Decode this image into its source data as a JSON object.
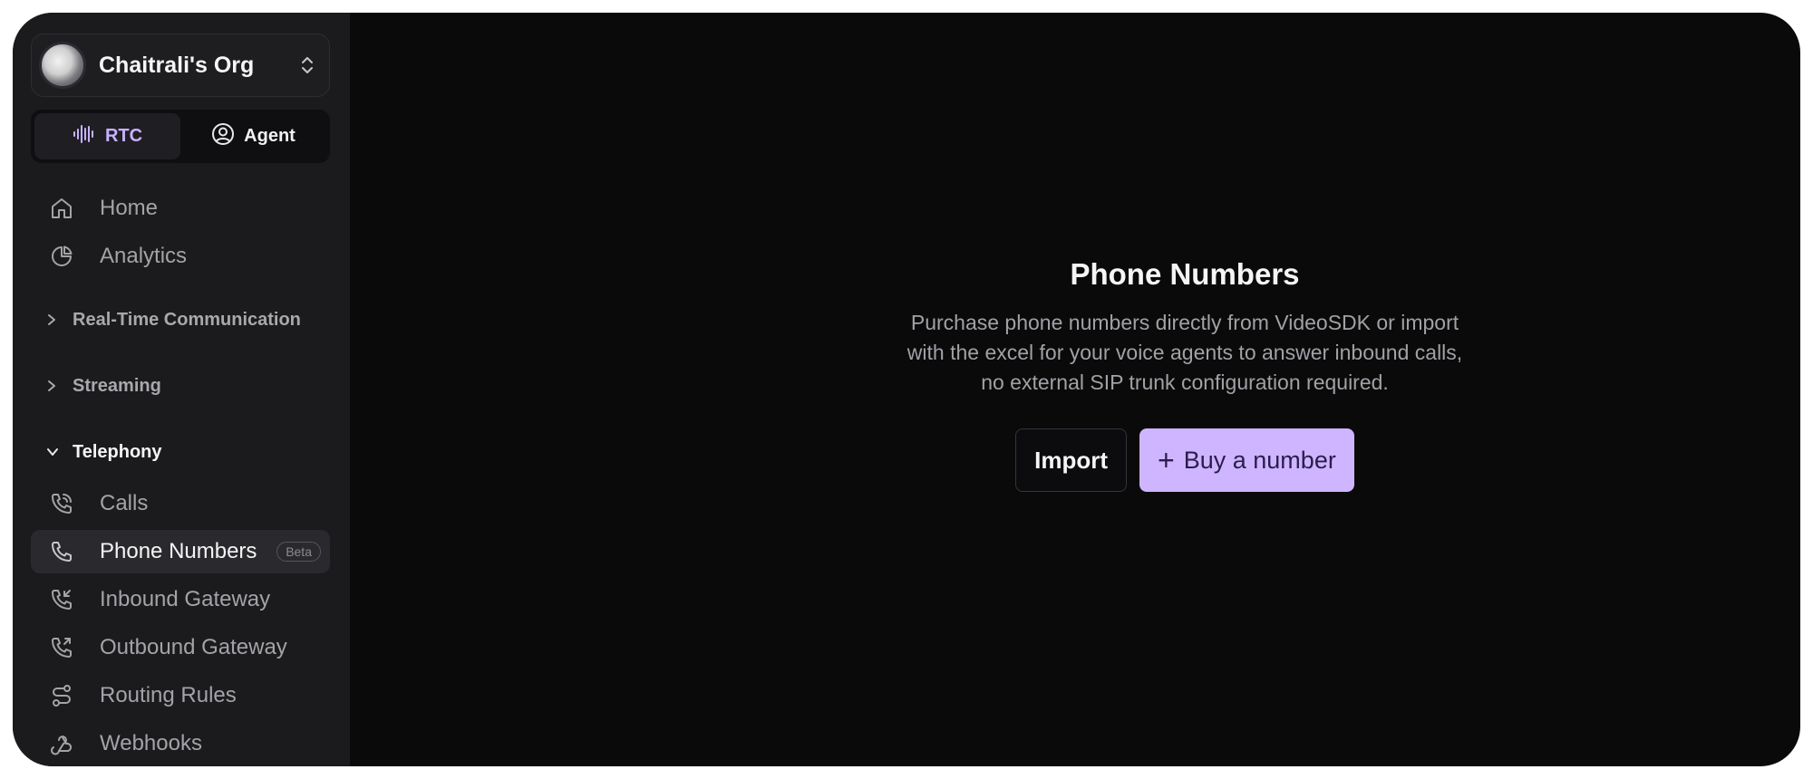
{
  "org": {
    "name": "Chaitrali's Org"
  },
  "mode_toggle": [
    {
      "label": "RTC",
      "icon": "audio-wave-icon",
      "active": true
    },
    {
      "label": "Agent",
      "icon": "user-circle-icon",
      "active": false
    }
  ],
  "nav_top": [
    {
      "label": "Home",
      "icon": "home-icon"
    },
    {
      "label": "Analytics",
      "icon": "pie-chart-icon"
    }
  ],
  "sections": [
    {
      "label": "Real-Time Communication",
      "open": false
    },
    {
      "label": "Streaming",
      "open": false
    },
    {
      "label": "Telephony",
      "open": true
    }
  ],
  "telephony_items": [
    {
      "label": "Calls",
      "icon": "phone-call-icon"
    },
    {
      "label": "Phone Numbers",
      "icon": "phone-icon",
      "selected": true,
      "badge": "Beta"
    },
    {
      "label": "Inbound Gateway",
      "icon": "phone-incoming-icon"
    },
    {
      "label": "Outbound Gateway",
      "icon": "phone-outgoing-icon"
    },
    {
      "label": "Routing Rules",
      "icon": "route-icon"
    },
    {
      "label": "Webhooks",
      "icon": "webhook-icon"
    }
  ],
  "main": {
    "title": "Phone Numbers",
    "description_lines": [
      "Purchase phone numbers directly from VideoSDK or import",
      "with the excel for your voice agents to answer inbound calls,",
      "no external SIP trunk configuration required."
    ],
    "import_label": "Import",
    "buy_label": "Buy a number"
  },
  "colors": {
    "accent": "#cfb5ff",
    "sidebar_bg": "#1b1b1d",
    "main_bg": "#0a0a0b"
  }
}
